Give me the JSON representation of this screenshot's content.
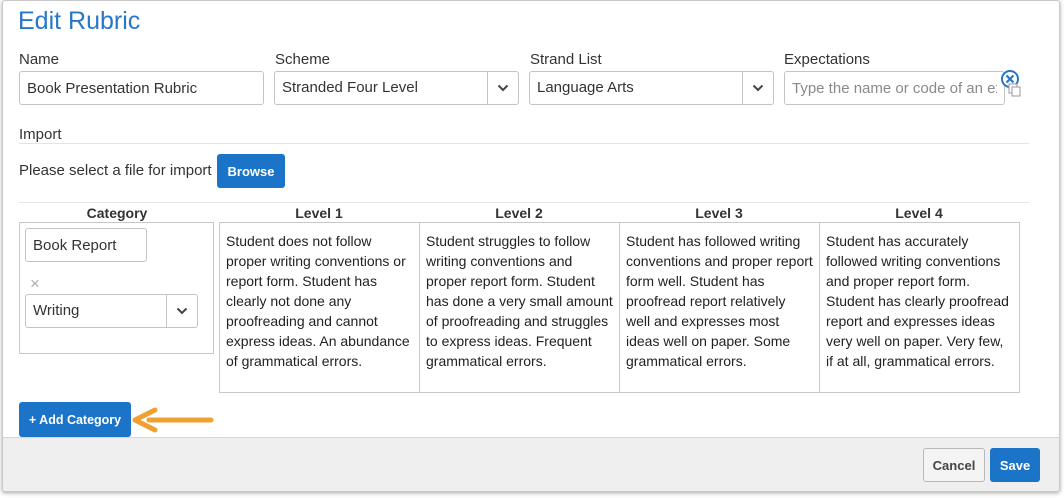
{
  "dialog": {
    "title": "Edit Rubric"
  },
  "fields": {
    "name_label": "Name",
    "name_value": "Book Presentation Rubric",
    "scheme_label": "Scheme",
    "scheme_value": "Stranded Four Level",
    "strand_label": "Strand List",
    "strand_value": "Language Arts",
    "expectations_label": "Expectations",
    "expectations_placeholder": "Type the name or code of an exp"
  },
  "import": {
    "label": "Import",
    "prompt": "Please select a file for import",
    "browse_label": "Browse"
  },
  "table": {
    "headers": [
      "Category",
      "Level 1",
      "Level 2",
      "Level 3",
      "Level 4"
    ],
    "category": {
      "name_value": "Book Report",
      "remove_glyph": "×",
      "strand_value": "Writing"
    },
    "levels": [
      "Student does not follow proper writing conventions or report form. Student has clearly not done any proofreading and cannot express ideas. An abundance of grammatical errors.",
      "Student struggles to follow writing conventions and proper report form. Student has done a very small amount of proofreading and struggles to express ideas. Frequent grammatical errors.",
      "Student has followed writing conventions and proper report form well. Student has proofread report relatively well and expresses most ideas well on paper. Some grammatical errors.",
      "Student has accurately followed writing conventions and proper report form. Student has clearly proofread report and expresses ideas very well on paper. Very few, if at all, grammatical errors."
    ],
    "add_category_label": "+ Add Category"
  },
  "footer": {
    "cancel_label": "Cancel",
    "save_label": "Save"
  },
  "colors": {
    "accent": "#1c74c8",
    "title": "#2878c8",
    "arrow": "#f0a030"
  },
  "icons": {
    "dropdown": "chevron-down-icon",
    "clear": "clear-circle-icon",
    "copy": "copy-icon",
    "pointer": "arrow-left-icon"
  }
}
